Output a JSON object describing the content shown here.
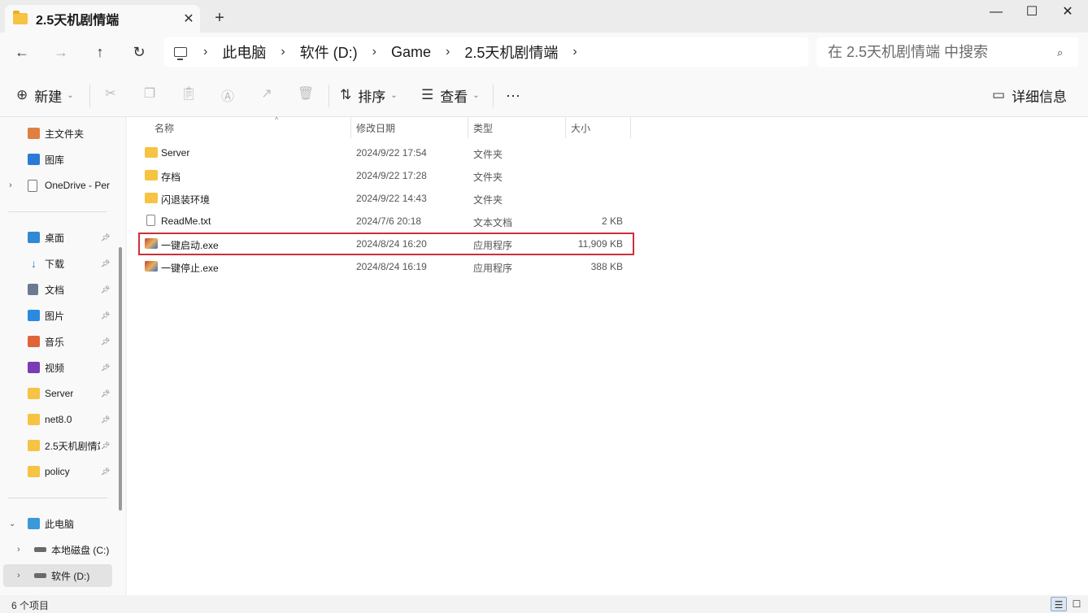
{
  "window": {
    "tab_title": "2.5天机剧情端",
    "close_tab": "✕",
    "new_tab": "+",
    "minimize": "—",
    "maximize": "☐",
    "close": "✕"
  },
  "nav": {
    "back": "←",
    "forward": "→",
    "up": "↑",
    "refresh": "↻",
    "breadcrumb": [
      "此电脑",
      "软件 (D:)",
      "Game",
      "2.5天机剧情端"
    ],
    "search_placeholder": "在 2.5天机剧情端 中搜索"
  },
  "toolbar": {
    "new_label": "新建",
    "sort_label": "排序",
    "view_label": "查看",
    "more": "···",
    "details_label": "详细信息"
  },
  "sidebar": {
    "quick": [
      {
        "label": "主文件夹",
        "icon": "home-icon"
      },
      {
        "label": "图库",
        "icon": "gallery-icon"
      },
      {
        "label": "OneDrive - Per",
        "icon": "onedrive-icon"
      }
    ],
    "pinned": [
      {
        "label": "桌面",
        "icon": "desktop-icon"
      },
      {
        "label": "下载",
        "icon": "download-icon"
      },
      {
        "label": "文档",
        "icon": "documents-icon"
      },
      {
        "label": "图片",
        "icon": "pictures-icon"
      },
      {
        "label": "音乐",
        "icon": "music-icon"
      },
      {
        "label": "视频",
        "icon": "videos-icon"
      },
      {
        "label": "Server",
        "icon": "folder-icon"
      },
      {
        "label": "net8.0",
        "icon": "folder-icon"
      },
      {
        "label": "2.5天机剧情端",
        "icon": "folder-icon"
      },
      {
        "label": "policy",
        "icon": "folder-icon"
      }
    ],
    "pc": {
      "label": "此电脑",
      "icon": "pc-icon"
    },
    "drives": [
      {
        "label": "本地磁盘 (C:)",
        "icon": "drive-icon"
      },
      {
        "label": "软件 (D:)",
        "icon": "drive-icon"
      }
    ]
  },
  "columns": {
    "name": "名称",
    "date": "修改日期",
    "type": "类型",
    "size": "大小"
  },
  "files": [
    {
      "name": "Server",
      "date": "2024/9/22 17:54",
      "type": "文件夹",
      "size": ""
    },
    {
      "name": "存档",
      "date": "2024/9/22 17:28",
      "type": "文件夹",
      "size": ""
    },
    {
      "name": "闪退装环境",
      "date": "2024/9/22 14:43",
      "type": "文件夹",
      "size": ""
    },
    {
      "name": "ReadMe.txt",
      "date": "2024/7/6 20:18",
      "type": "文本文档",
      "size": "2 KB"
    },
    {
      "name": "一键启动.exe",
      "date": "2024/8/24 16:20",
      "type": "应用程序",
      "size": "11,909 KB"
    },
    {
      "name": "一键停止.exe",
      "date": "2024/8/24 16:19",
      "type": "应用程序",
      "size": "388 KB"
    }
  ],
  "status": {
    "count": "6 个项目"
  },
  "colors": {
    "highlight_border": "#c8323a",
    "folder": "#f6c342"
  }
}
